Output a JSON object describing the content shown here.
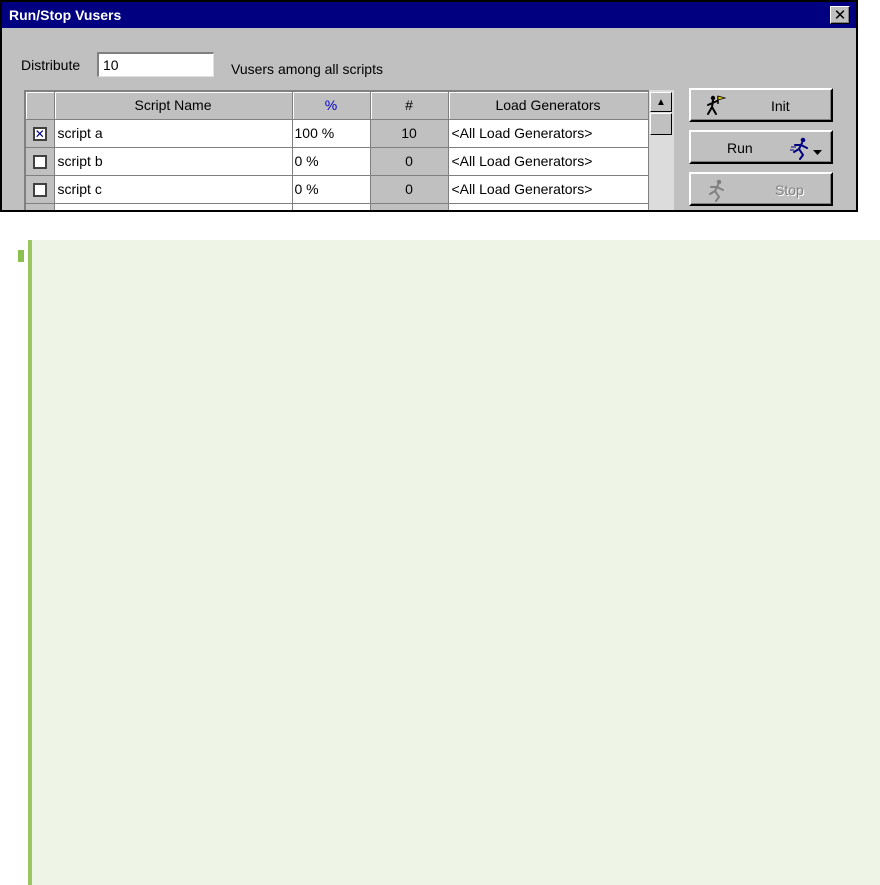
{
  "window": {
    "title": "Run/Stop Vusers",
    "close_glyph": "✕"
  },
  "distribute": {
    "label": "Distribute",
    "value": "10",
    "suffix": "Vusers among all scripts"
  },
  "grid": {
    "headers": {
      "name": "Script Name",
      "percent": "%",
      "count": "#",
      "generators": "Load Generators"
    },
    "rows": [
      {
        "checked": true,
        "check_glyph": "✕",
        "name": "script a",
        "percent": "100 %",
        "count": "10",
        "generators": "<All Load Generators>"
      },
      {
        "checked": false,
        "check_glyph": "",
        "name": "script b",
        "percent": "0 %",
        "count": "0",
        "generators": "<All Load Generators>"
      },
      {
        "checked": false,
        "check_glyph": "",
        "name": "script c",
        "percent": "0 %",
        "count": "0",
        "generators": "<All Load Generators>"
      }
    ]
  },
  "buttons": {
    "init": {
      "label": "Init",
      "icon": "runner-flag-icon"
    },
    "run": {
      "label": "Run",
      "icon": "runner-icon"
    },
    "stop": {
      "label": "Stop",
      "icon": "runner-stop-icon",
      "disabled": true
    }
  },
  "colors": {
    "titlebar": "#000080",
    "dialog": "#c0c0c0",
    "panel_bg": "#eef4e6",
    "panel_border": "#9cc760"
  }
}
